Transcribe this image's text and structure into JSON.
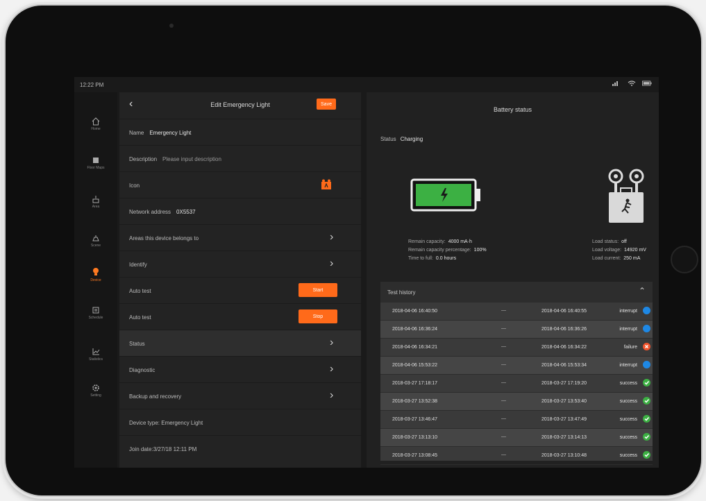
{
  "statusbar": {
    "time": "12:22 PM"
  },
  "nav": {
    "items": [
      {
        "label": "Home",
        "icon": "home-icon"
      },
      {
        "label": "Floor Maps",
        "icon": "floor-maps-icon"
      },
      {
        "label": "Area",
        "icon": "area-icon"
      },
      {
        "label": "Scene",
        "icon": "scene-icon"
      },
      {
        "label": "Device",
        "icon": "bulb-icon",
        "active": true
      },
      {
        "label": "Schedule",
        "icon": "schedule-icon"
      },
      {
        "label": "Statistics",
        "icon": "statistics-icon"
      },
      {
        "label": "Setting",
        "icon": "gear-icon"
      }
    ]
  },
  "edit": {
    "title": "Edit Emergency Light",
    "save_label": "Save",
    "name_label": "Name",
    "name_value": "Emergency Light",
    "description_label": "Description",
    "description_placeholder": "Please input description",
    "icon_label": "Icon",
    "network_label": "Network address",
    "network_value": "0X5537",
    "areas_label": "Areas this device belongs to",
    "identify_label": "Identify",
    "autotest1_label": "Auto test",
    "autotest1_btn": "Start",
    "autotest2_label": "Auto test",
    "autotest2_btn": "Stop",
    "status_label": "Status",
    "diagnostic_label": "Diagnostic",
    "backup_label": "Backup and recovery",
    "device_type": "Device type: Emergency Light",
    "join_date": "Join date:3/27/18 12:11 PM"
  },
  "battery": {
    "title": "Battery status",
    "status_label": "Status",
    "status_value": "Charging",
    "remain_capacity_label": "Remain capacity:",
    "remain_capacity_value": "4000 mA·h",
    "remain_pct_label": "Remain capacity percentage:",
    "remain_pct_value": "100%",
    "time_full_label": "Time to full:",
    "time_full_value": "0.0 hours",
    "load_status_label": "Load status:",
    "load_status_value": "off",
    "load_voltage_label": "Load voltage:",
    "load_voltage_value": "14920 mV",
    "load_current_label": "Load current:",
    "load_current_value": "250 mA",
    "level_fraction": 1.0
  },
  "test_history": {
    "title": "Test history",
    "rows": [
      {
        "start": "2018-04-06 16:40:50",
        "end": "2018-04-06 16:40:55",
        "result": "interrupt",
        "status": "info"
      },
      {
        "start": "2018-04-06 16:36:24",
        "end": "2018-04-06 16:36:26",
        "result": "interrupt",
        "status": "info"
      },
      {
        "start": "2018-04-06 16:34:21",
        "end": "2018-04-06 16:34:22",
        "result": "failure",
        "status": "error"
      },
      {
        "start": "2018-04-06 15:53:22",
        "end": "2018-04-06 15:53:34",
        "result": "interrupt",
        "status": "info"
      },
      {
        "start": "2018-03-27 17:18:17",
        "end": "2018-03-27 17:19:20",
        "result": "success",
        "status": "ok"
      },
      {
        "start": "2018-03-27 13:52:38",
        "end": "2018-03-27 13:53:40",
        "result": "success",
        "status": "ok"
      },
      {
        "start": "2018-03-27 13:46:47",
        "end": "2018-03-27 13:47:49",
        "result": "success",
        "status": "ok"
      },
      {
        "start": "2018-03-27 13:13:10",
        "end": "2018-03-27 13:14:13",
        "result": "success",
        "status": "ok"
      },
      {
        "start": "2018-03-27 13:08:45",
        "end": "2018-03-27 13:10:48",
        "result": "success",
        "status": "ok"
      }
    ]
  },
  "colors": {
    "accent": "#ff6a1a",
    "ok": "#3cb043",
    "info": "#1e88e5",
    "error": "#f2542d"
  }
}
